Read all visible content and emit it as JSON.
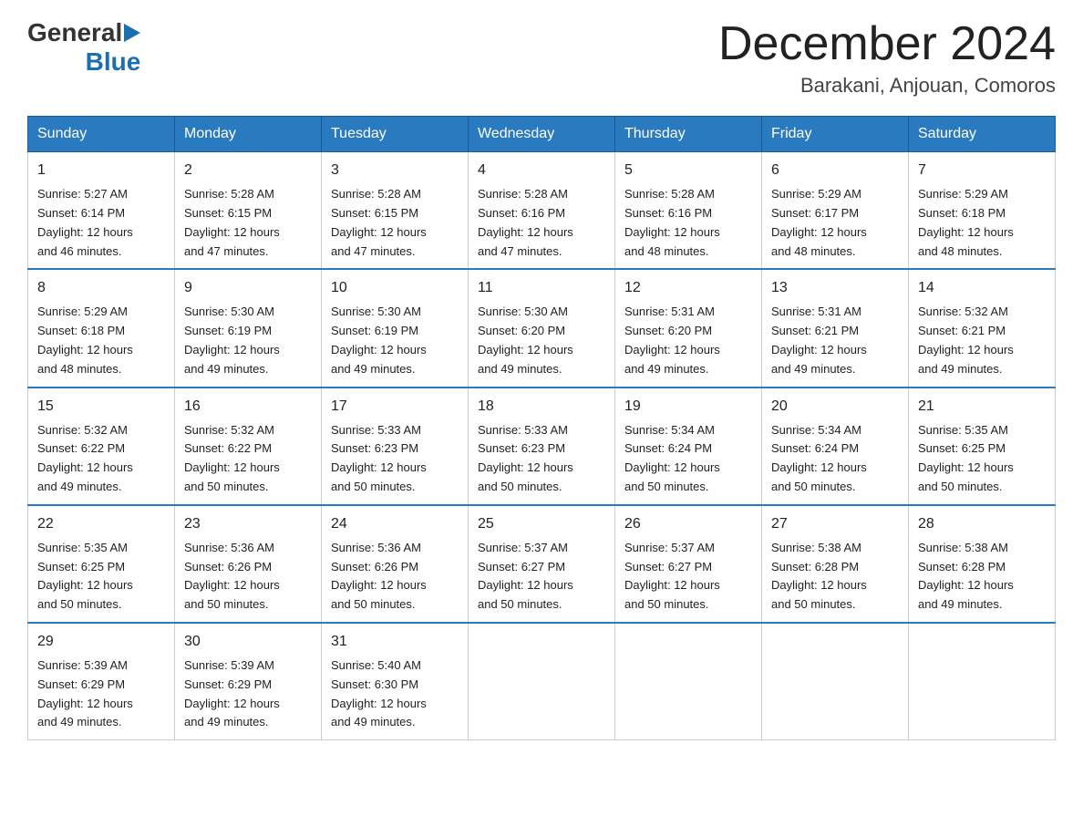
{
  "header": {
    "logo": {
      "general": "General",
      "blue": "Blue"
    },
    "title": "December 2024",
    "subtitle": "Barakani, Anjouan, Comoros"
  },
  "days_of_week": [
    "Sunday",
    "Monday",
    "Tuesday",
    "Wednesday",
    "Thursday",
    "Friday",
    "Saturday"
  ],
  "weeks": [
    [
      {
        "day": "1",
        "sunrise": "5:27 AM",
        "sunset": "6:14 PM",
        "daylight": "12 hours and 46 minutes."
      },
      {
        "day": "2",
        "sunrise": "5:28 AM",
        "sunset": "6:15 PM",
        "daylight": "12 hours and 47 minutes."
      },
      {
        "day": "3",
        "sunrise": "5:28 AM",
        "sunset": "6:15 PM",
        "daylight": "12 hours and 47 minutes."
      },
      {
        "day": "4",
        "sunrise": "5:28 AM",
        "sunset": "6:16 PM",
        "daylight": "12 hours and 47 minutes."
      },
      {
        "day": "5",
        "sunrise": "5:28 AM",
        "sunset": "6:16 PM",
        "daylight": "12 hours and 48 minutes."
      },
      {
        "day": "6",
        "sunrise": "5:29 AM",
        "sunset": "6:17 PM",
        "daylight": "12 hours and 48 minutes."
      },
      {
        "day": "7",
        "sunrise": "5:29 AM",
        "sunset": "6:18 PM",
        "daylight": "12 hours and 48 minutes."
      }
    ],
    [
      {
        "day": "8",
        "sunrise": "5:29 AM",
        "sunset": "6:18 PM",
        "daylight": "12 hours and 48 minutes."
      },
      {
        "day": "9",
        "sunrise": "5:30 AM",
        "sunset": "6:19 PM",
        "daylight": "12 hours and 49 minutes."
      },
      {
        "day": "10",
        "sunrise": "5:30 AM",
        "sunset": "6:19 PM",
        "daylight": "12 hours and 49 minutes."
      },
      {
        "day": "11",
        "sunrise": "5:30 AM",
        "sunset": "6:20 PM",
        "daylight": "12 hours and 49 minutes."
      },
      {
        "day": "12",
        "sunrise": "5:31 AM",
        "sunset": "6:20 PM",
        "daylight": "12 hours and 49 minutes."
      },
      {
        "day": "13",
        "sunrise": "5:31 AM",
        "sunset": "6:21 PM",
        "daylight": "12 hours and 49 minutes."
      },
      {
        "day": "14",
        "sunrise": "5:32 AM",
        "sunset": "6:21 PM",
        "daylight": "12 hours and 49 minutes."
      }
    ],
    [
      {
        "day": "15",
        "sunrise": "5:32 AM",
        "sunset": "6:22 PM",
        "daylight": "12 hours and 49 minutes."
      },
      {
        "day": "16",
        "sunrise": "5:32 AM",
        "sunset": "6:22 PM",
        "daylight": "12 hours and 50 minutes."
      },
      {
        "day": "17",
        "sunrise": "5:33 AM",
        "sunset": "6:23 PM",
        "daylight": "12 hours and 50 minutes."
      },
      {
        "day": "18",
        "sunrise": "5:33 AM",
        "sunset": "6:23 PM",
        "daylight": "12 hours and 50 minutes."
      },
      {
        "day": "19",
        "sunrise": "5:34 AM",
        "sunset": "6:24 PM",
        "daylight": "12 hours and 50 minutes."
      },
      {
        "day": "20",
        "sunrise": "5:34 AM",
        "sunset": "6:24 PM",
        "daylight": "12 hours and 50 minutes."
      },
      {
        "day": "21",
        "sunrise": "5:35 AM",
        "sunset": "6:25 PM",
        "daylight": "12 hours and 50 minutes."
      }
    ],
    [
      {
        "day": "22",
        "sunrise": "5:35 AM",
        "sunset": "6:25 PM",
        "daylight": "12 hours and 50 minutes."
      },
      {
        "day": "23",
        "sunrise": "5:36 AM",
        "sunset": "6:26 PM",
        "daylight": "12 hours and 50 minutes."
      },
      {
        "day": "24",
        "sunrise": "5:36 AM",
        "sunset": "6:26 PM",
        "daylight": "12 hours and 50 minutes."
      },
      {
        "day": "25",
        "sunrise": "5:37 AM",
        "sunset": "6:27 PM",
        "daylight": "12 hours and 50 minutes."
      },
      {
        "day": "26",
        "sunrise": "5:37 AM",
        "sunset": "6:27 PM",
        "daylight": "12 hours and 50 minutes."
      },
      {
        "day": "27",
        "sunrise": "5:38 AM",
        "sunset": "6:28 PM",
        "daylight": "12 hours and 50 minutes."
      },
      {
        "day": "28",
        "sunrise": "5:38 AM",
        "sunset": "6:28 PM",
        "daylight": "12 hours and 49 minutes."
      }
    ],
    [
      {
        "day": "29",
        "sunrise": "5:39 AM",
        "sunset": "6:29 PM",
        "daylight": "12 hours and 49 minutes."
      },
      {
        "day": "30",
        "sunrise": "5:39 AM",
        "sunset": "6:29 PM",
        "daylight": "12 hours and 49 minutes."
      },
      {
        "day": "31",
        "sunrise": "5:40 AM",
        "sunset": "6:30 PM",
        "daylight": "12 hours and 49 minutes."
      },
      null,
      null,
      null,
      null
    ]
  ],
  "labels": {
    "sunrise": "Sunrise:",
    "sunset": "Sunset:",
    "daylight": "Daylight:"
  }
}
